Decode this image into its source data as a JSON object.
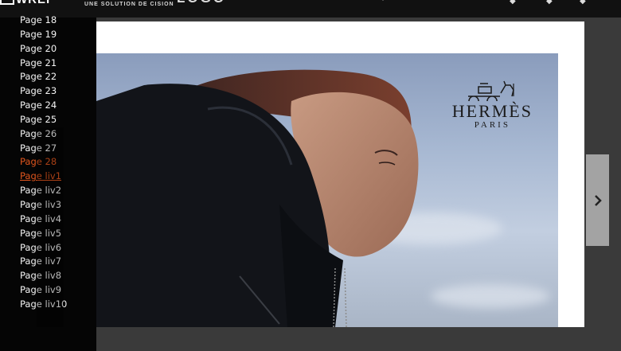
{
  "header": {
    "brand_partial": "WREI",
    "brand_sub": "UNE SOLUTION DE CISION",
    "brand_big": "LOGO"
  },
  "sidebar": {
    "pages": [
      {
        "label": "Page 18",
        "state": "normal"
      },
      {
        "label": "Page 19",
        "state": "normal"
      },
      {
        "label": "Page 20",
        "state": "normal"
      },
      {
        "label": "Page 21",
        "state": "normal"
      },
      {
        "label": "Page 22",
        "state": "normal"
      },
      {
        "label": "Page 23",
        "state": "normal"
      },
      {
        "label": "Page 24",
        "state": "normal"
      },
      {
        "label": "Page 25",
        "state": "normal"
      },
      {
        "label": "Page 26",
        "state": "normal"
      },
      {
        "label": "Page 27",
        "state": "normal"
      },
      {
        "label": "Page 28",
        "state": "active"
      },
      {
        "label": "Page liv1",
        "state": "current"
      },
      {
        "label": "Page liv2",
        "state": "normal"
      },
      {
        "label": "Page liv3",
        "state": "normal"
      },
      {
        "label": "Page liv4",
        "state": "normal"
      },
      {
        "label": "Page liv5",
        "state": "normal"
      },
      {
        "label": "Page liv6",
        "state": "normal"
      },
      {
        "label": "Page liv7",
        "state": "normal"
      },
      {
        "label": "Page liv8",
        "state": "normal"
      },
      {
        "label": "Page liv9",
        "state": "normal"
      },
      {
        "label": "Page liv10",
        "state": "normal"
      }
    ]
  },
  "ad": {
    "brand": "HERMÈS",
    "city": "PARIS"
  },
  "colors": {
    "accent": "#e0551d",
    "topbar": "#111111",
    "sidebar": "#050505",
    "viewer_bg": "#3a3a3a",
    "next_button": "#a3a3a3"
  },
  "icons": {
    "next": "chevron-right-icon"
  }
}
